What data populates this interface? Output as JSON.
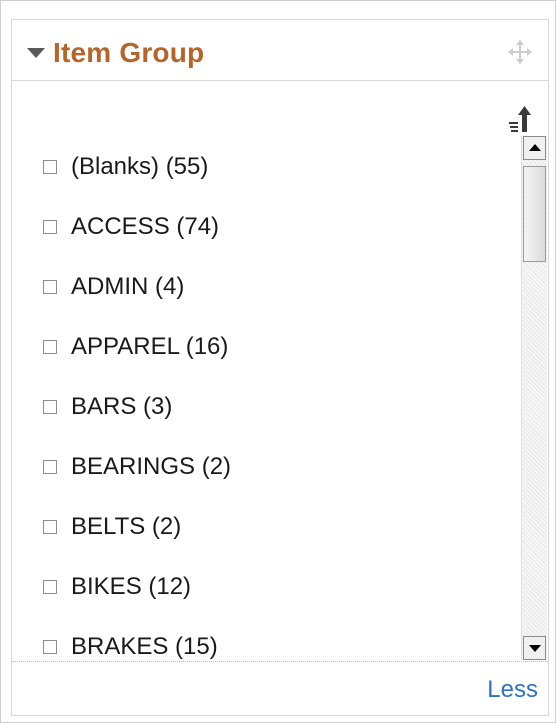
{
  "panel": {
    "title": "Item Group",
    "icons": {
      "collapse": "caret-down-icon",
      "move": "move-icon",
      "sort": "sort-ascending-icon"
    }
  },
  "items": [
    {
      "label": "(Blanks) (55)",
      "checked": false
    },
    {
      "label": "ACCESS (74)",
      "checked": false
    },
    {
      "label": "ADMIN (4)",
      "checked": false
    },
    {
      "label": "APPAREL (16)",
      "checked": false
    },
    {
      "label": "BARS (3)",
      "checked": false
    },
    {
      "label": "BEARINGS (2)",
      "checked": false
    },
    {
      "label": "BELTS (2)",
      "checked": false
    },
    {
      "label": "BIKES (12)",
      "checked": false
    },
    {
      "label": "BRAKES (15)",
      "checked": false
    }
  ],
  "footer": {
    "less_label": "Less"
  },
  "colors": {
    "title": "#b5652a",
    "link": "#2d74c4"
  }
}
